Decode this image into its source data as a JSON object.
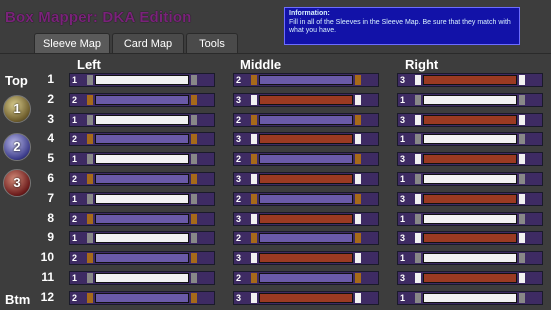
{
  "app": {
    "title": "Box Mapper: DKA Edition"
  },
  "info": {
    "header": "Information:",
    "text": "Fill in all of the Sleeves in the Sleeve Map. Be sure that they match with what you have."
  },
  "tabs": [
    {
      "label": "Sleeve Map",
      "active": true
    },
    {
      "label": "Card Map",
      "active": false
    },
    {
      "label": "Tools",
      "active": false
    }
  ],
  "columns": [
    "Left",
    "Middle",
    "Right"
  ],
  "side": {
    "top": "Top",
    "bottom": "Btm"
  },
  "players": [
    "1",
    "2",
    "3"
  ],
  "colors": {
    "1": {
      "bg": "#3e2b63",
      "bar": "#f2f2f2",
      "end": "#888888"
    },
    "2": {
      "bg": "#3e2b63",
      "bar": "#6a5aa8",
      "end": "#a66a1a"
    },
    "3": {
      "bg": "#3e2b63",
      "bar": "#9b3a22",
      "end": "#f2f2f2"
    }
  },
  "rows": [
    {
      "label": "1",
      "cells": [
        "1",
        "2",
        "3"
      ]
    },
    {
      "label": "2",
      "cells": [
        "2",
        "3",
        "1"
      ]
    },
    {
      "label": "3",
      "cells": [
        "1",
        "2",
        "3"
      ]
    },
    {
      "label": "4",
      "cells": [
        "2",
        "3",
        "1"
      ]
    },
    {
      "label": "5",
      "cells": [
        "1",
        "2",
        "3"
      ]
    },
    {
      "label": "6",
      "cells": [
        "2",
        "3",
        "1"
      ]
    },
    {
      "label": "7",
      "cells": [
        "1",
        "2",
        "3"
      ]
    },
    {
      "label": "8",
      "cells": [
        "2",
        "3",
        "1"
      ]
    },
    {
      "label": "9",
      "cells": [
        "1",
        "2",
        "3"
      ]
    },
    {
      "label": "10",
      "cells": [
        "2",
        "3",
        "1"
      ]
    },
    {
      "label": "11",
      "cells": [
        "1",
        "2",
        "3"
      ]
    },
    {
      "label": "12",
      "cells": [
        "2",
        "3",
        "1"
      ]
    }
  ]
}
